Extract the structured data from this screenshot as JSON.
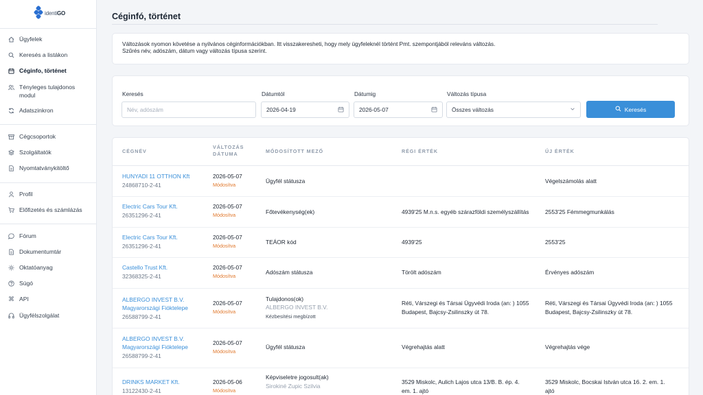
{
  "logo": {
    "prefix": "identi",
    "suffix": "GO"
  },
  "sidebar": {
    "items": [
      {
        "label": "Ügyfelek",
        "icon": "home-icon"
      },
      {
        "label": "Keresés a listákon",
        "icon": "search-icon"
      },
      {
        "label": "Céginfo, történet",
        "icon": "calendar-icon"
      },
      {
        "label": "Tényleges tulajdonos modul",
        "icon": "users-icon"
      },
      {
        "label": "Adatszinkron",
        "icon": "sync-icon"
      },
      {
        "label": "Cégcsoportok",
        "icon": "archive-icon"
      },
      {
        "label": "Szolgáltatók",
        "icon": "layers-icon"
      },
      {
        "label": "Nyomtatványkitöltő",
        "icon": "document-icon"
      },
      {
        "label": "Profil",
        "icon": "user-icon"
      },
      {
        "label": "Előfizetés és számlázás",
        "icon": "cart-icon"
      },
      {
        "label": "Fórum",
        "icon": "chat-icon"
      },
      {
        "label": "Dokumentumtár",
        "icon": "document-icon"
      },
      {
        "label": "Oktatóanyag",
        "icon": "sun-icon"
      },
      {
        "label": "Súgó",
        "icon": "help-icon"
      },
      {
        "label": "API",
        "icon": "command-icon"
      },
      {
        "label": "Ügyfélszolgálat",
        "icon": "headphones-icon"
      }
    ]
  },
  "page": {
    "title": "Céginfó, történet",
    "info_line1": "Változások nyomon követése a nyilvános céginformációkban. Itt visszakeresheti, hogy mely ügyfeleknél történt Pmt. szempontjából releváns változás.",
    "info_line2": "Szűrés név, adószám, dátum vagy változás típusa szerint."
  },
  "filters": {
    "search_label": "Keresés",
    "search_placeholder": "Név, adószám",
    "date_from_label": "Dátumtól",
    "date_from_value": "2026-04-19",
    "date_to_label": "Dátumig",
    "date_to_value": "2026-05-07",
    "type_label": "Változás típusa",
    "type_value": "Összes változás",
    "search_button": "Keresés"
  },
  "table": {
    "headers": {
      "company": "CÉGNÉV",
      "date_line1": "VÁLTOZÁS",
      "date_line2": "DÁTUMA",
      "field": "MÓDOSÍTOTT MEZŐ",
      "old": "RÉGI ÉRTÉK",
      "new": "ÚJ ÉRTÉK"
    },
    "rows": [
      {
        "name": "HUNYADI 11 OTTHON Kft",
        "name2": "",
        "tax": "24868710-2-41",
        "date": "2026-05-07",
        "status": "Módosítva",
        "field": "Ügyfél státusza",
        "field_sub": "",
        "field_note": "",
        "old": "",
        "old2": "",
        "new": "Végelszámolás alatt",
        "new2": ""
      },
      {
        "name": "Electric Cars Tour Kft.",
        "name2": "",
        "tax": "26351296-2-41",
        "date": "2026-05-07",
        "status": "Módosítva",
        "field": "Főtevékenység(ek)",
        "field_sub": "",
        "field_note": "",
        "old": "4939'25 M.n.s. egyéb szárazföldi személyszállítás",
        "old2": "",
        "new": "2553'25 Fémmegmunkálás",
        "new2": ""
      },
      {
        "name": "Electric Cars Tour Kft.",
        "name2": "",
        "tax": "26351296-2-41",
        "date": "2026-05-07",
        "status": "Módosítva",
        "field": "TEÁOR kód",
        "field_sub": "",
        "field_note": "",
        "old": "4939'25",
        "old2": "",
        "new": "2553'25",
        "new2": ""
      },
      {
        "name": "Castello Trust Kft.",
        "name2": "",
        "tax": "32368325-2-41",
        "date": "2026-05-07",
        "status": "Módosítva",
        "field": "Adószám státusza",
        "field_sub": "",
        "field_note": "",
        "old": "Törölt adószám",
        "old2": "",
        "new": "Érvényes adószám",
        "new2": ""
      },
      {
        "name": "ALBERGO INVEST B.V.",
        "name2": "Magyarországi Fióktelepe",
        "tax": "26588799-2-41",
        "date": "2026-05-07",
        "status": "Módosítva",
        "field": "Tulajdonos(ok)",
        "field_sub": "ALBERGO INVEST B.V.",
        "field_note": "Kézbesítési megbízott",
        "old": "Réti, Várszegi és Társai Ügyvédi Iroda (an: ) 1055",
        "old2": "Budapest, Bajcsy-Zsilinszky út 78.",
        "new": "Réti, Várszegi és Társai Ügyvédi Iroda (an: ) 1055",
        "new2": "Budapest, Bajcsy-Zsilinszky út 78."
      },
      {
        "name": "ALBERGO INVEST B.V.",
        "name2": "Magyarországi Fióktelepe",
        "tax": "26588799-2-41",
        "date": "2026-05-07",
        "status": "Módosítva",
        "field": "Ügyfél státusza",
        "field_sub": "",
        "field_note": "",
        "old": "Végrehajtás alatt",
        "old2": "",
        "new": "Végrehajtás vége",
        "new2": ""
      },
      {
        "name": "DRINKS MARKET Kft.",
        "name2": "",
        "tax": "13122430-2-41",
        "date": "2026-05-06",
        "status": "Módosítva",
        "field": "Képviseletre jogosult(ak)",
        "field_sub": "Sirokiné Zupic Szilvia",
        "field_note": "",
        "old": "3529 Miskolc, Aulich Lajos utca 13/B. B. ép. 4.",
        "old2": "em. 1. ajtó",
        "new": "3529 Miskolc, Bocskai István utca 16. 2. em. 1.",
        "new2": "ajtó"
      }
    ]
  }
}
